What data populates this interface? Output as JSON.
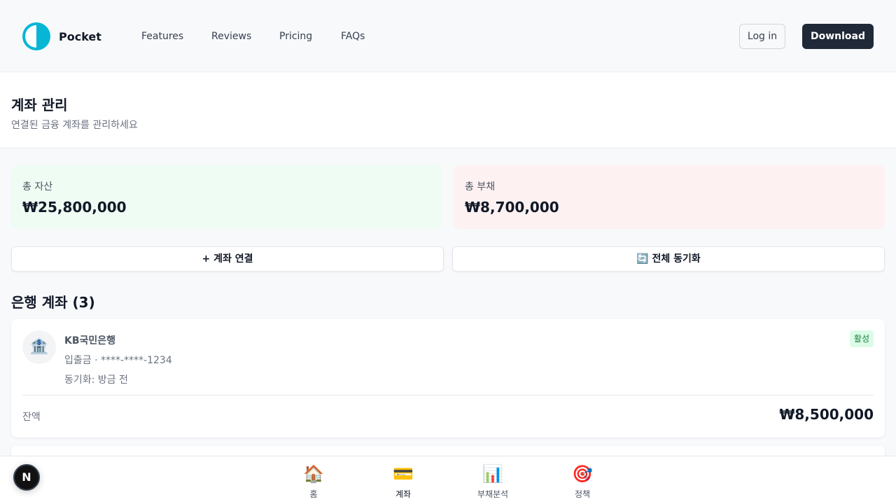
{
  "nav": {
    "brand": "Pocket",
    "links": [
      "Features",
      "Reviews",
      "Pricing",
      "FAQs"
    ],
    "login": "Log in",
    "download": "Download"
  },
  "header": {
    "title": "계좌 관리",
    "subtitle": "연결된 금융 계좌를 관리하세요"
  },
  "summary": {
    "assets_label": "총 자산",
    "assets_value": "₩25,800,000",
    "liabilities_label": "총 부채",
    "liabilities_value": "₩8,700,000"
  },
  "actions": {
    "connect": "+ 계좌 연결",
    "sync": "🔄 전체 동기화"
  },
  "section": {
    "title": "은행 계좌 (3)"
  },
  "accounts": [
    {
      "icon": "🏦",
      "bank": "KB국민은행",
      "type": "입출금 · ****-****-1234",
      "sync": "동기화: 방금 전",
      "status": "활성",
      "balance_label": "잔액",
      "balance": "₩8,500,000"
    }
  ],
  "bottom_nav": [
    {
      "icon": "🏠",
      "label": "홈"
    },
    {
      "icon": "💳",
      "label": "계좌"
    },
    {
      "icon": "📊",
      "label": "부채분석"
    },
    {
      "icon": "🎯",
      "label": "정책"
    }
  ],
  "dev_badge": "N",
  "colors": {
    "brand": "#06b6d4",
    "primary_button": "#1f2937",
    "assets_bg": "#effcf3",
    "liabilities_bg": "#fef1f1",
    "active_badge": "#dcfce7"
  }
}
